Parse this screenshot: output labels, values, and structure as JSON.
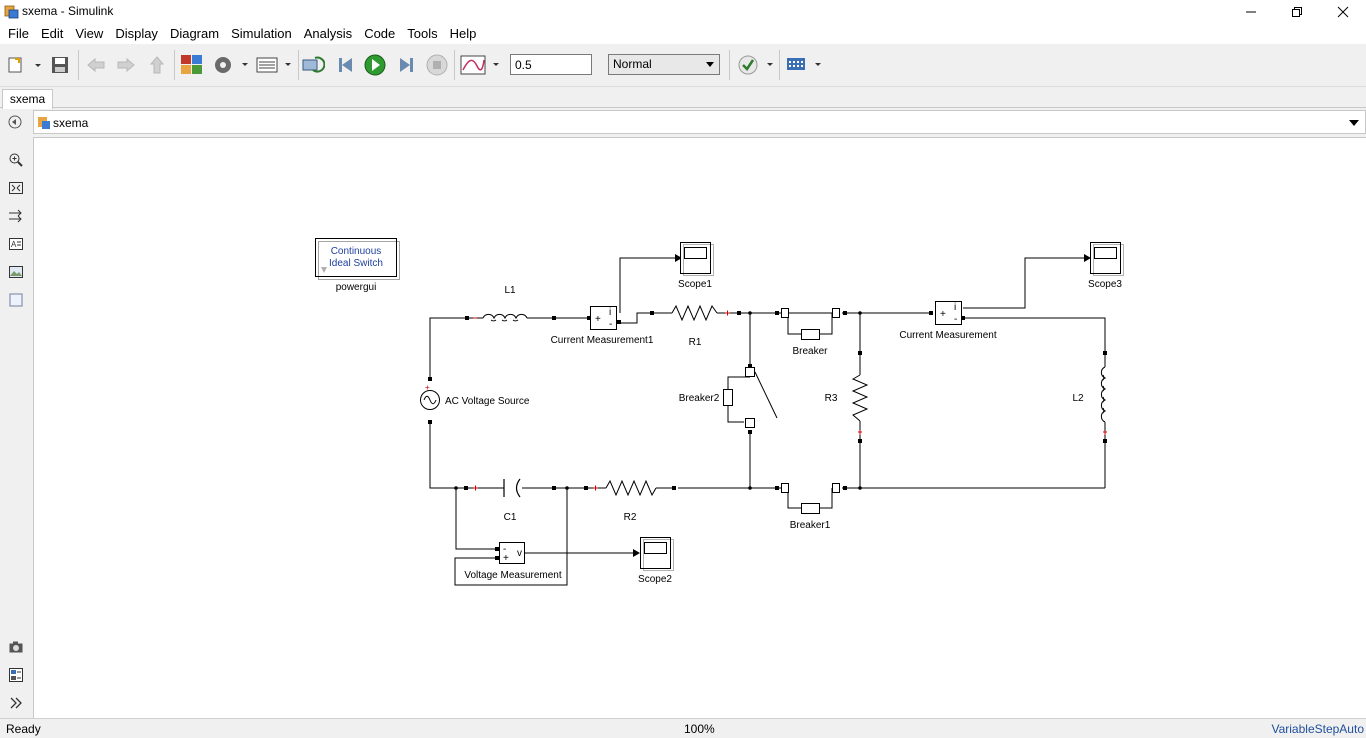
{
  "window": {
    "title": "sxema - Simulink"
  },
  "menu": [
    "File",
    "Edit",
    "View",
    "Display",
    "Diagram",
    "Simulation",
    "Analysis",
    "Code",
    "Tools",
    "Help"
  ],
  "toolbar": {
    "stop_time": "0.5",
    "sim_mode": "Normal"
  },
  "tab": {
    "label": "sxema"
  },
  "address": {
    "crumb": "sxema"
  },
  "diagram": {
    "powergui": {
      "line1": "Continuous",
      "line2": "Ideal Switch",
      "label": "powergui"
    },
    "labels": {
      "l1": "L1",
      "current_measurement1": "Current Measurement1",
      "scope1": "Scope1",
      "r1": "R1",
      "breaker": "Breaker",
      "current_measurement": "Current Measurement",
      "scope3": "Scope3",
      "ac_source": "AC Voltage Source",
      "breaker2": "Breaker2",
      "r3": "R3",
      "l2": "L2",
      "c1": "C1",
      "r2": "R2",
      "breaker1": "Breaker1",
      "voltage_measurement": "Voltage Measurement",
      "scope2": "Scope2"
    },
    "port_labels": {
      "plus": "+",
      "minus": "-",
      "i": "i",
      "v": "v"
    }
  },
  "status": {
    "left": "Ready",
    "zoom": "100%",
    "solver": "VariableStepAuto"
  },
  "colors": {
    "accent": "#1f4e9c",
    "wire": "#000000",
    "port": "#d00000"
  }
}
